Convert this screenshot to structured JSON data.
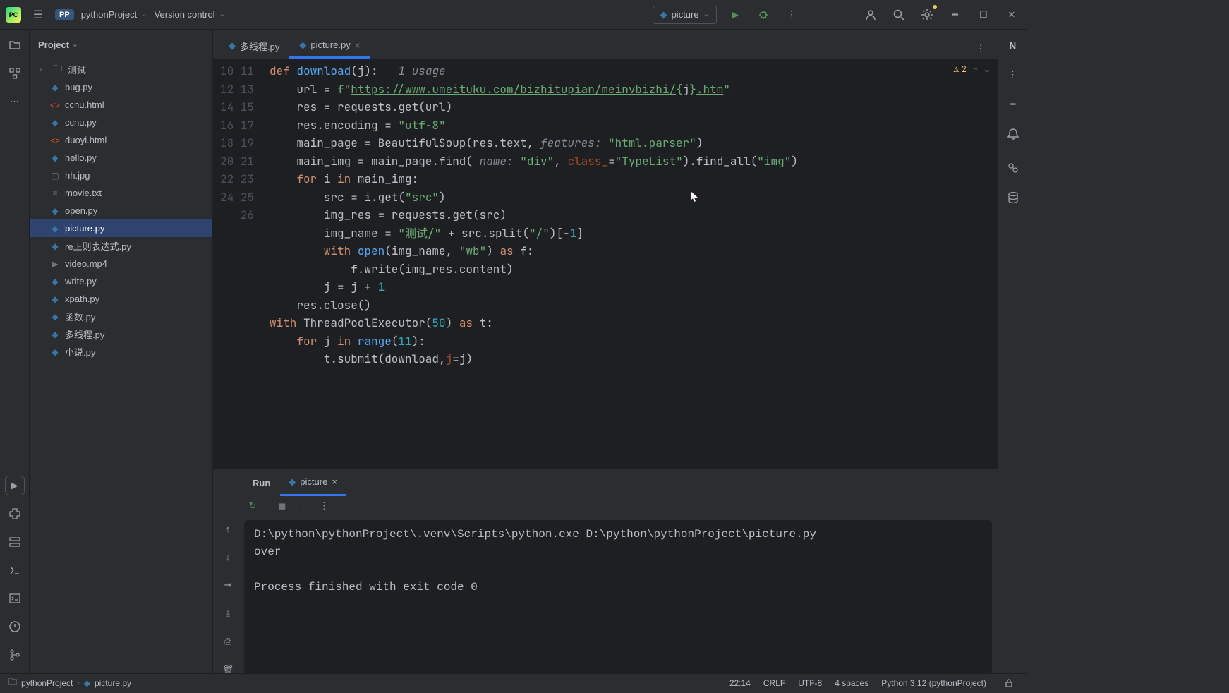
{
  "titlebar": {
    "project_name": "pythonProject",
    "project_badge": "PP",
    "vcs_label": "Version control"
  },
  "run_config": {
    "name": "picture"
  },
  "project_panel": {
    "title": "Project",
    "folder": "测试",
    "files": [
      {
        "name": "bug.py",
        "icon_cls": "py-file-icon",
        "glyph": "◆"
      },
      {
        "name": "ccnu.html",
        "icon_cls": "html-file-icon",
        "glyph": "<>"
      },
      {
        "name": "ccnu.py",
        "icon_cls": "py-file-icon",
        "glyph": "◆"
      },
      {
        "name": "duoyi.html",
        "icon_cls": "html-file-icon",
        "glyph": "<>"
      },
      {
        "name": "hello.py",
        "icon_cls": "py-file-icon",
        "glyph": "◆"
      },
      {
        "name": "hh.jpg",
        "icon_cls": "img-file-icon",
        "glyph": "▢"
      },
      {
        "name": "movie.txt",
        "icon_cls": "txt-file-icon",
        "glyph": "≡"
      },
      {
        "name": "open.py",
        "icon_cls": "py-file-icon",
        "glyph": "◆"
      },
      {
        "name": "picture.py",
        "icon_cls": "py-file-icon",
        "glyph": "◆",
        "selected": true
      },
      {
        "name": "re正则表达式.py",
        "icon_cls": "py-file-icon",
        "glyph": "◆"
      },
      {
        "name": "video.mp4",
        "icon_cls": "vid-file-icon",
        "glyph": "▶"
      },
      {
        "name": "write.py",
        "icon_cls": "py-file-icon",
        "glyph": "◆"
      },
      {
        "name": "xpath.py",
        "icon_cls": "py-file-icon",
        "glyph": "◆"
      },
      {
        "name": "函数.py",
        "icon_cls": "py-file-icon",
        "glyph": "◆"
      },
      {
        "name": "多线程.py",
        "icon_cls": "py-file-icon",
        "glyph": "◆"
      },
      {
        "name": "小说.py",
        "icon_cls": "py-file-icon",
        "glyph": "◆"
      }
    ]
  },
  "tabs": [
    {
      "label": "多线程.py",
      "active": false,
      "closable": false
    },
    {
      "label": "picture.py",
      "active": true,
      "closable": true
    }
  ],
  "code": {
    "first_line": 10,
    "warning_count": 2,
    "usage_hint": "1 usage",
    "lines_html": [
      "<span class='kw'>def</span> <span class='fn'>download</span>(j):   <span class='hint'>1 usage</span>",
      "    url = <span class='str'>f\"</span><span class='str-url'>https://www.umeituku.com/bizhitupian/meinvbizhi/</span><span class='str'>{</span>j<span class='str'>}</span><span class='str-url'>.htm</span><span class='str'>\"</span>",
      "    res = requests.get(url)",
      "    res.encoding = <span class='str'>\"utf-8\"</span>",
      "    main_page = BeautifulSoup(res.text, <span class='hint'>features:</span> <span class='str'>\"html.parser\"</span>)",
      "    main_img = main_page.find( <span class='hint'>name:</span> <span class='str'>\"div\"</span>, <span class='param'>class_</span>=<span class='str'>\"TypeList\"</span>).find_all(<span class='str'>\"img\"</span>)",
      "    <span class='kw'>for</span> i <span class='kw'>in</span> main_img:",
      "        src = i.get(<span class='str'>\"src\"</span>)",
      "        img_res = requests.get(src)",
      "        img_name = <span class='str'>\"测试/\"</span> + src.split(<span class='str'>\"/\"</span>)[-<span class='num'>1</span>]",
      "        <span class='kw'>with</span> <span class='fn'>open</span>(img_name, <span class='str'>\"wb\"</span>) <span class='kw'>as</span> f:",
      "            f.write(img_res.content)",
      "        j = j + <span class='num'>1</span>",
      "    res.close()",
      "<span class='kw'>with</span> ThreadPoolExecutor(<span class='num'>50</span>) <span class='kw'>as</span> t:",
      "    <span class='kw'>for</span> j <span class='kw'>in</span> <span class='fn'>range</span>(<span class='num'>11</span>):",
      "        t.submit(download,<span class='param'>j</span>=j)"
    ]
  },
  "run_panel": {
    "title": "Run",
    "tab_name": "picture",
    "output_lines": [
      "D:\\python\\pythonProject\\.venv\\Scripts\\python.exe D:\\python\\pythonProject\\picture.py",
      "over",
      "",
      "Process finished with exit code 0"
    ]
  },
  "statusbar": {
    "breadcrumb_project": "pythonProject",
    "breadcrumb_file": "picture.py",
    "cursor": "22:14",
    "line_sep": "CRLF",
    "encoding": "UTF-8",
    "indent": "4 spaces",
    "interpreter": "Python 3.12 (pythonProject)"
  },
  "right_panel": {
    "indicator": "N"
  }
}
